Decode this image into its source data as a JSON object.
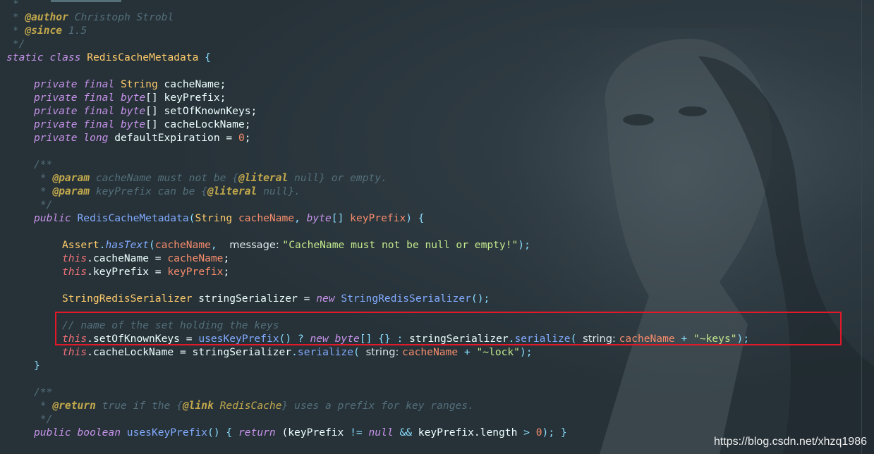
{
  "lines": {
    "l1": "*",
    "l2": {
      "star": " * ",
      "tag": "@author",
      "text": " Christoph Strobl"
    },
    "l3": {
      "star": " * ",
      "tag": "@since",
      "text": " 1.5"
    },
    "l4": " */",
    "l5": {
      "kw": "static class ",
      "cls": "RedisCacheMetadata",
      "brace": " {"
    },
    "l6": {
      "kw": "private final ",
      "ty": "String",
      "name": " cacheName;"
    },
    "l7": {
      "kw": "private final ",
      "ty": "byte",
      "name": "[] keyPrefix;"
    },
    "l8": {
      "kw": "private final ",
      "ty": "byte",
      "name": "[] setOfKnownKeys;"
    },
    "l9": {
      "kw": "private final ",
      "ty": "byte",
      "name": "[] cacheLockName;"
    },
    "l10": {
      "kw": "private long ",
      "name": "defaultExpiration = ",
      "num": "0",
      "end": ";"
    },
    "l11": "/**",
    "l12": {
      "star": " * ",
      "tag": "@param",
      "p": " cacheName",
      "t1": " must not be {",
      "lit": "@literal",
      "t2": " null} or empty."
    },
    "l13": {
      "star": " * ",
      "tag": "@param",
      "p": " keyPrefix",
      "t1": " can be {",
      "lit": "@literal",
      "t2": " null}."
    },
    "l14": " */",
    "l15": {
      "kw": "public ",
      "cls": "RedisCacheMetadata",
      "p1": "(",
      "ty1": "String",
      "a1": " cacheName",
      "c1": ", ",
      "ty2": "byte",
      "br": "[] ",
      "a2": "keyPrefix",
      "end": ") {"
    },
    "l16": {
      "cls": "Assert",
      "dot": ".",
      "m": "hasText",
      "p1": "(",
      "a1": "cacheName",
      "c1": ",  ",
      "hint": "message: ",
      "s": "\"CacheName must not be null or empty!\"",
      "end": ");"
    },
    "l17": {
      "th": "this",
      "f": ".cacheName = ",
      "a": "cacheName",
      "end": ";"
    },
    "l18": {
      "th": "this",
      "f": ".keyPrefix = ",
      "a": "keyPrefix",
      "end": ";"
    },
    "l19": {
      "ty": "StringRedisSerializer",
      "v": " stringSerializer = ",
      "kw": "new ",
      "cls": "StringRedisSerializer",
      "end": "();"
    },
    "l20": "// name of the set holding the keys",
    "l21": {
      "th": "this",
      "f": ".setOfKnownKeys = ",
      "m": "usesKeyPrefix",
      "p": "() ? ",
      "kw": "new ",
      "ty": "byte",
      "br": "[] {} : ",
      "v": "stringSerializer",
      "dot": ".",
      "m2": "serialize",
      "p2": "( ",
      "hint": "string: ",
      "a": "cacheName",
      "plus": " + ",
      "s": "\"~keys\"",
      "end": ");"
    },
    "l22": {
      "th": "this",
      "f": ".cacheLockName = ",
      "v": "stringSerializer",
      "dot": ".",
      "m2": "serialize",
      "p2": "( ",
      "hint": "string: ",
      "a": "cacheName",
      "plus": " + ",
      "s": "\"~lock\"",
      "end": ");"
    },
    "l23": "}",
    "l24": "/**",
    "l25": {
      "star": " * ",
      "tag": "@return",
      "t1": " true if the {",
      "lk": "@link",
      "cls": " RedisCache",
      "t2": "} uses a prefix for key ranges."
    },
    "l26": " */",
    "l27": {
      "kw": "public boolean ",
      "m": "usesKeyPrefix",
      "p": "() { ",
      "kw2": "return ",
      "e1": "(keyPrefix ",
      "op": "!=",
      "kw3": " null ",
      "op2": "&&",
      "e2": " keyPrefix.length ",
      "op3": ">",
      "num": " 0",
      "end": "); }"
    }
  },
  "watermark": "https://blog.csdn.net/xhzq1986",
  "colors": {
    "background": "#263238",
    "highlight_box": "#e3192a"
  }
}
